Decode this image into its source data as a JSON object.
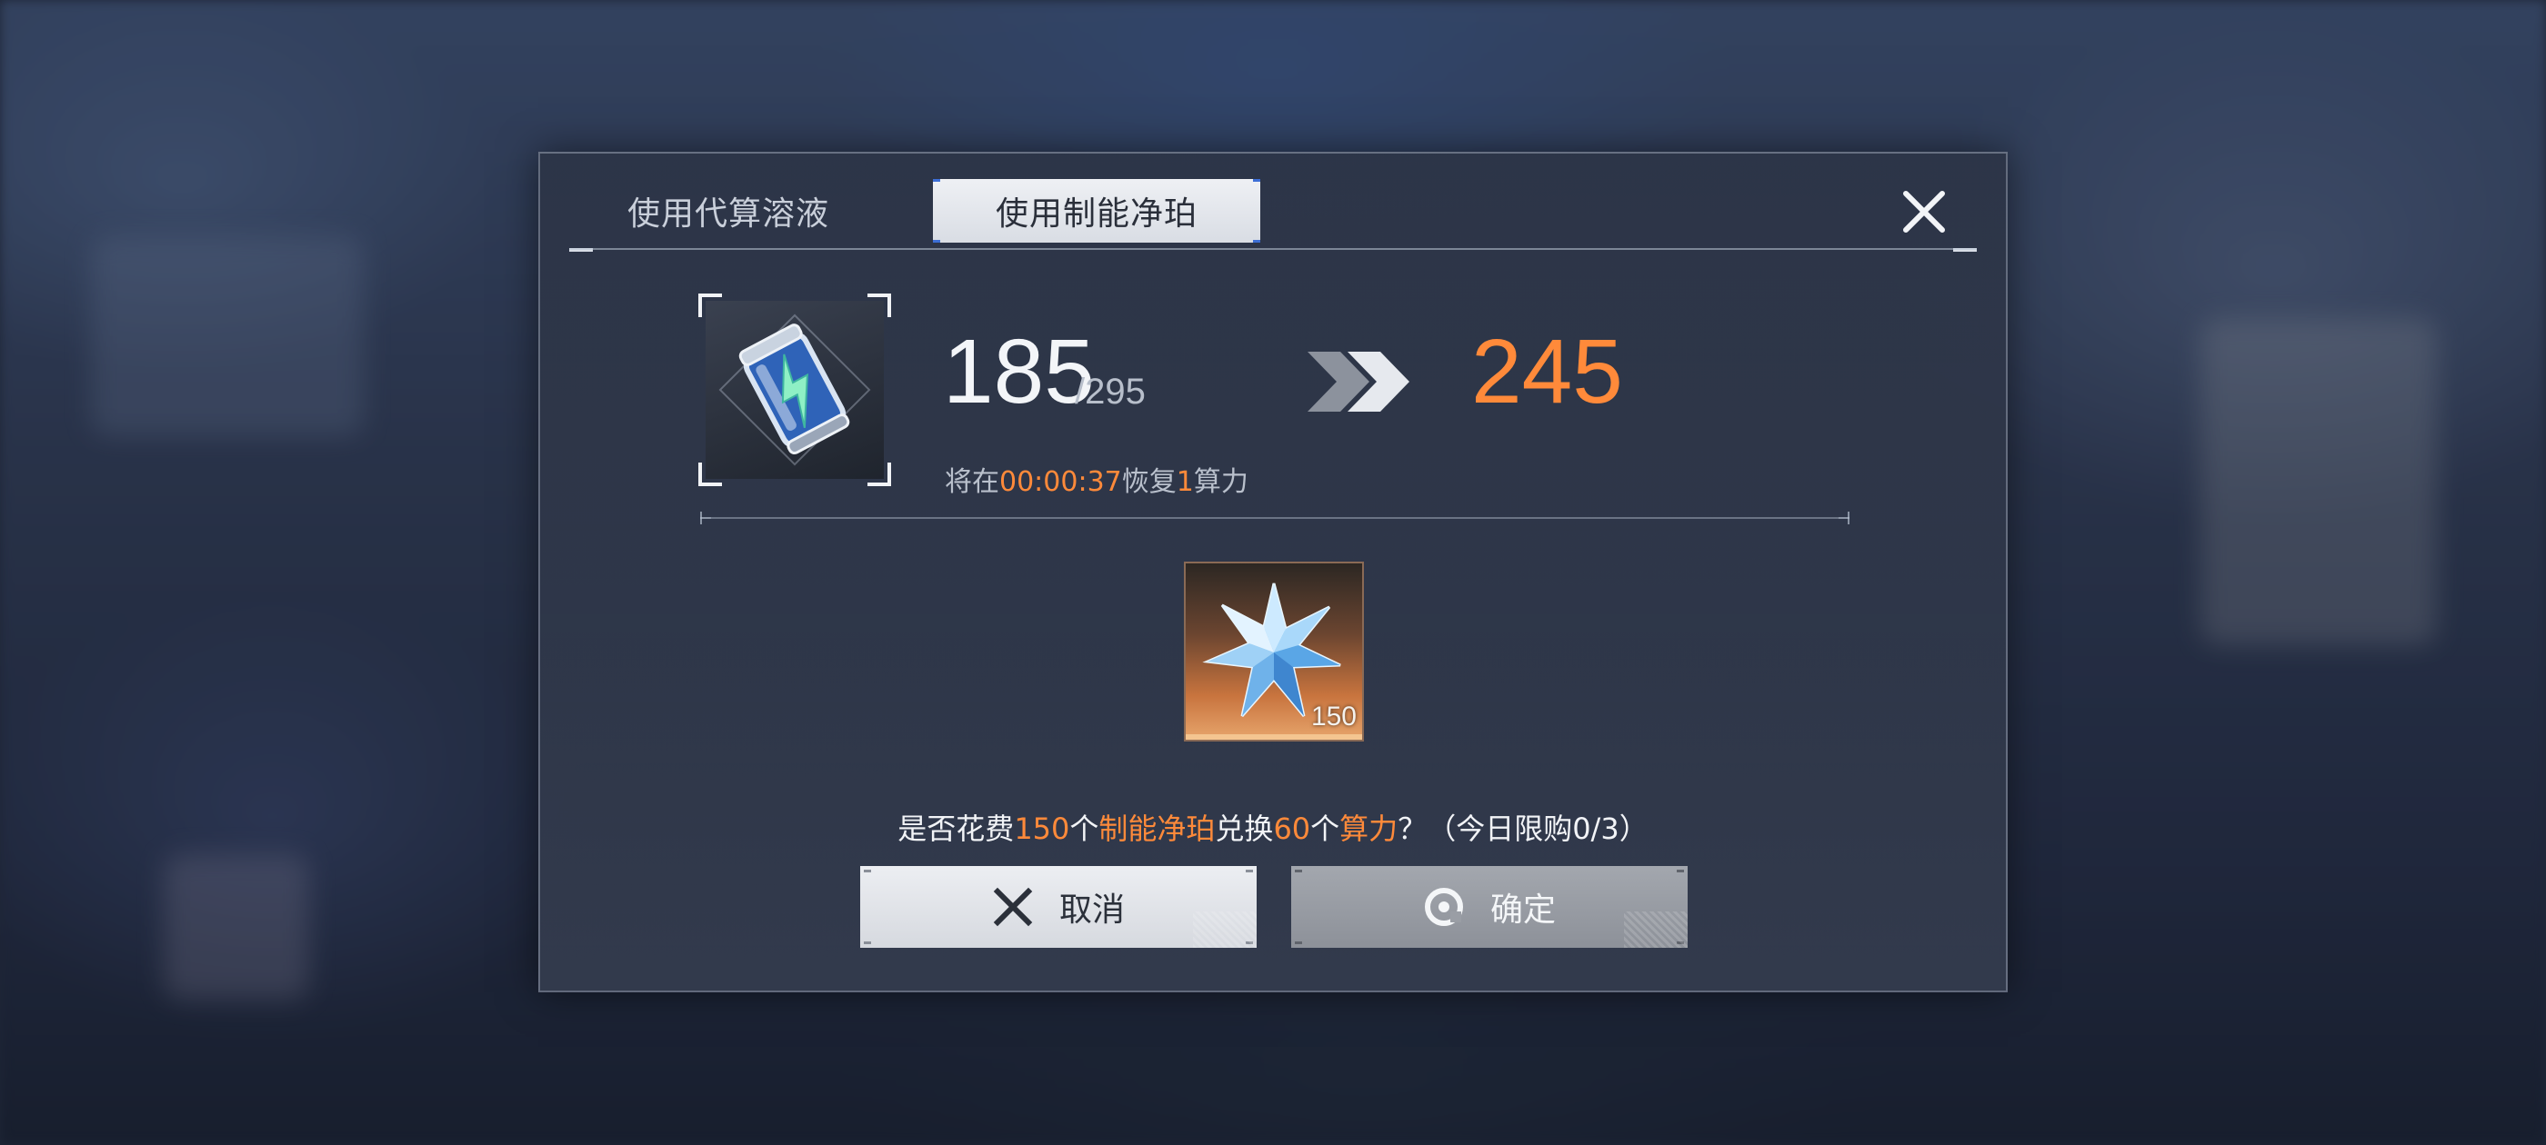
{
  "tabs": [
    {
      "label": "使用代算溶液",
      "active": false
    },
    {
      "label": "使用制能净珀",
      "active": true
    }
  ],
  "exchange": {
    "current": "185",
    "max": "/295",
    "result": "245",
    "recover_prefix": "将在",
    "recover_time": "00:00:37",
    "recover_mid": "恢复",
    "recover_amount": "1",
    "recover_suffix": "算力",
    "source_item_icon": "energy-canister-icon",
    "cost_item_icon": "crystal-star-icon",
    "cost_quantity": "150"
  },
  "question": {
    "p1": "是否花费",
    "cost": "150",
    "p2": "个",
    "item": "制能净珀",
    "p3": "兑换",
    "gain": "60",
    "p4": "个",
    "resource": "算力",
    "p5": "？（今日限购0/3）"
  },
  "buttons": {
    "cancel": "取消",
    "confirm": "确定"
  },
  "colors": {
    "accent": "#ff8a3a",
    "tab_marker": "#3d6fd6"
  }
}
